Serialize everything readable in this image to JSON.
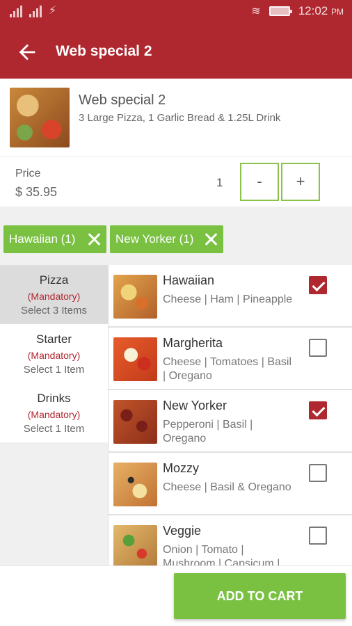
{
  "status_bar": {
    "time": "12:02",
    "ampm": "PM"
  },
  "app_bar": {
    "title": "Web special 2"
  },
  "product": {
    "name": "Web special 2",
    "description": "3 Large Pizza, 1 Garlic Bread & 1.25L Drink"
  },
  "price": {
    "label": "Price",
    "value": "$ 35.95",
    "quantity": "1",
    "minus_label": "-",
    "plus_label": "+"
  },
  "chips": [
    {
      "label": "Hawaiian (1)"
    },
    {
      "label": "New Yorker (1)"
    }
  ],
  "categories": [
    {
      "name": "Pizza",
      "mandatory": "(Mandatory)",
      "select": "Select 3 Items",
      "active": true
    },
    {
      "name": "Starter",
      "mandatory": "(Mandatory)",
      "select": "Select 1 Item",
      "active": false
    },
    {
      "name": "Drinks",
      "mandatory": "(Mandatory)",
      "select": "Select 1 Item",
      "active": false
    }
  ],
  "items": [
    {
      "name": "Hawaiian",
      "ingredients": "Cheese | Ham | Pineapple",
      "checked": true
    },
    {
      "name": "Margherita",
      "ingredients": "Cheese | Tomatoes | Basil | Oregano",
      "checked": false
    },
    {
      "name": "New Yorker",
      "ingredients": "Pepperoni | Basil | Oregano",
      "checked": true
    },
    {
      "name": "Mozzy",
      "ingredients": "Cheese | Basil & Oregano",
      "checked": false
    },
    {
      "name": "Veggie",
      "ingredients": "Onion | Tomato | Mushroom | Capsicum |",
      "checked": false
    }
  ],
  "cart_button": {
    "label": "ADD TO CART"
  },
  "colors": {
    "primary": "#b0282f",
    "accent_green": "#7ac142",
    "button_border": "#8bc34a"
  }
}
